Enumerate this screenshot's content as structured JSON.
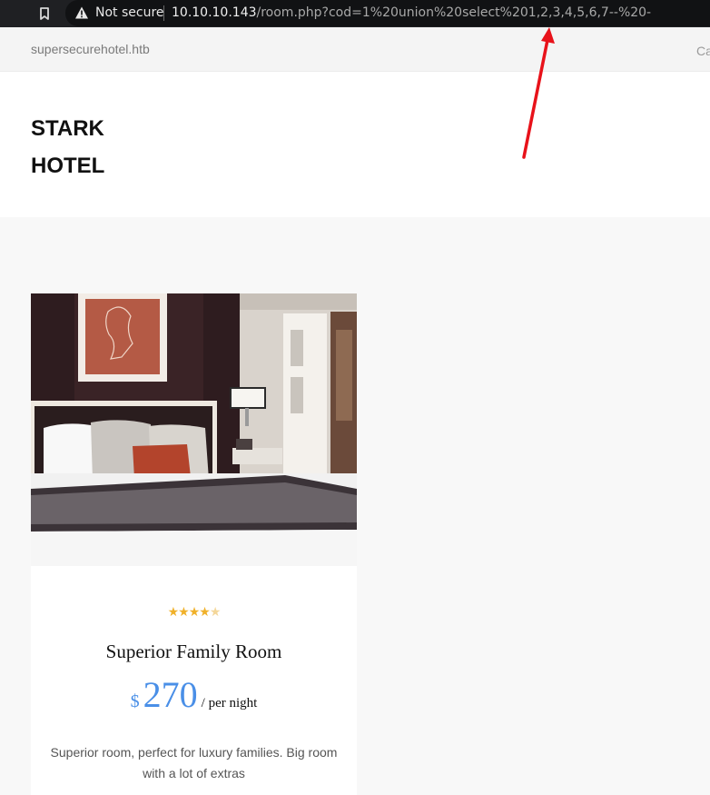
{
  "browser": {
    "security_label": "Not secure",
    "url_host": "10.10.10.143",
    "url_path": "/room.php?cod=1%20union%20select%201,2,3,4,5,6,7--%20-",
    "icons": [
      "bookmark-icon",
      "warning-icon"
    ]
  },
  "site": {
    "domain": "supersecurehotel.htb",
    "topbar_right": "Ca",
    "logo_line1": "STARK",
    "logo_line2": "HOTEL"
  },
  "room": {
    "rating": 4,
    "rating_max": 5,
    "title": "Superior Family Room",
    "currency": "$",
    "price": "270",
    "price_unit": "/ per night",
    "description": "Superior room, perfect for luxury families. Big room with a lot of extras"
  },
  "colors": {
    "accent": "#4a8fe7",
    "star": "#f0b12a",
    "annotation": "#e8121a"
  }
}
